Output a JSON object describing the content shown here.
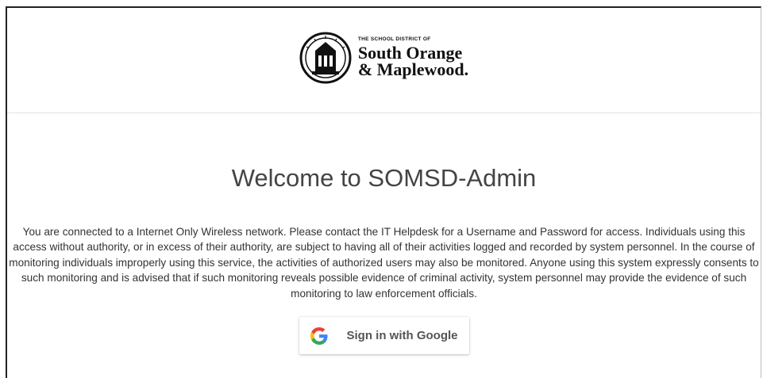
{
  "header": {
    "logo": {
      "small_text": "THE SCHOOL DISTRICT OF",
      "line1": "South Orange",
      "line2": "& Maplewood."
    }
  },
  "main": {
    "title": "Welcome to SOMSD-Admin",
    "notice": "You are connected to a Internet Only Wireless network. Please contact the IT Helpdesk for a Username and Password for access. Individuals using this access without authority, or in excess of their authority, are subject to having all of their activities logged and recorded by system personnel. In the course of monitoring individuals improperly using this service, the activities of authorized users may also be monitored. Anyone using this system expressly consents to such monitoring and is advised that if such monitoring reveals possible evidence of criminal activity, system personnel may provide the evidence of such monitoring to law enforcement officials.",
    "google_button": {
      "label": "Sign in with Google",
      "icon": "google-g-icon"
    }
  },
  "colors": {
    "google_blue": "#4285F4",
    "google_red": "#EA4335",
    "google_yellow": "#FBBC05",
    "google_green": "#34A853",
    "text": "#333333"
  }
}
